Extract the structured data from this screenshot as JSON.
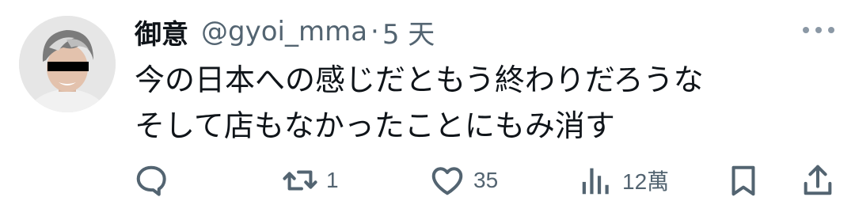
{
  "author": {
    "display_name": "御意",
    "handle": "@gyoi_mma",
    "separator": "·",
    "time": "5 天",
    "avatar_icon": "user-avatar"
  },
  "tweet": {
    "lines": [
      "今の日本への感じだともう終わりだろうな",
      "そして店もなかったことにもみ消す"
    ]
  },
  "actions": {
    "reply": {
      "icon": "reply-icon",
      "count": ""
    },
    "retweet": {
      "icon": "retweet-icon",
      "count": "1"
    },
    "like": {
      "icon": "heart-icon",
      "count": "35"
    },
    "views": {
      "icon": "views-icon",
      "count": "12萬"
    },
    "bookmark": {
      "icon": "bookmark-icon",
      "count": ""
    },
    "share": {
      "icon": "share-icon",
      "count": ""
    }
  },
  "colors": {
    "text": "#0f1419",
    "muted": "#536471",
    "background": "#ffffff"
  }
}
